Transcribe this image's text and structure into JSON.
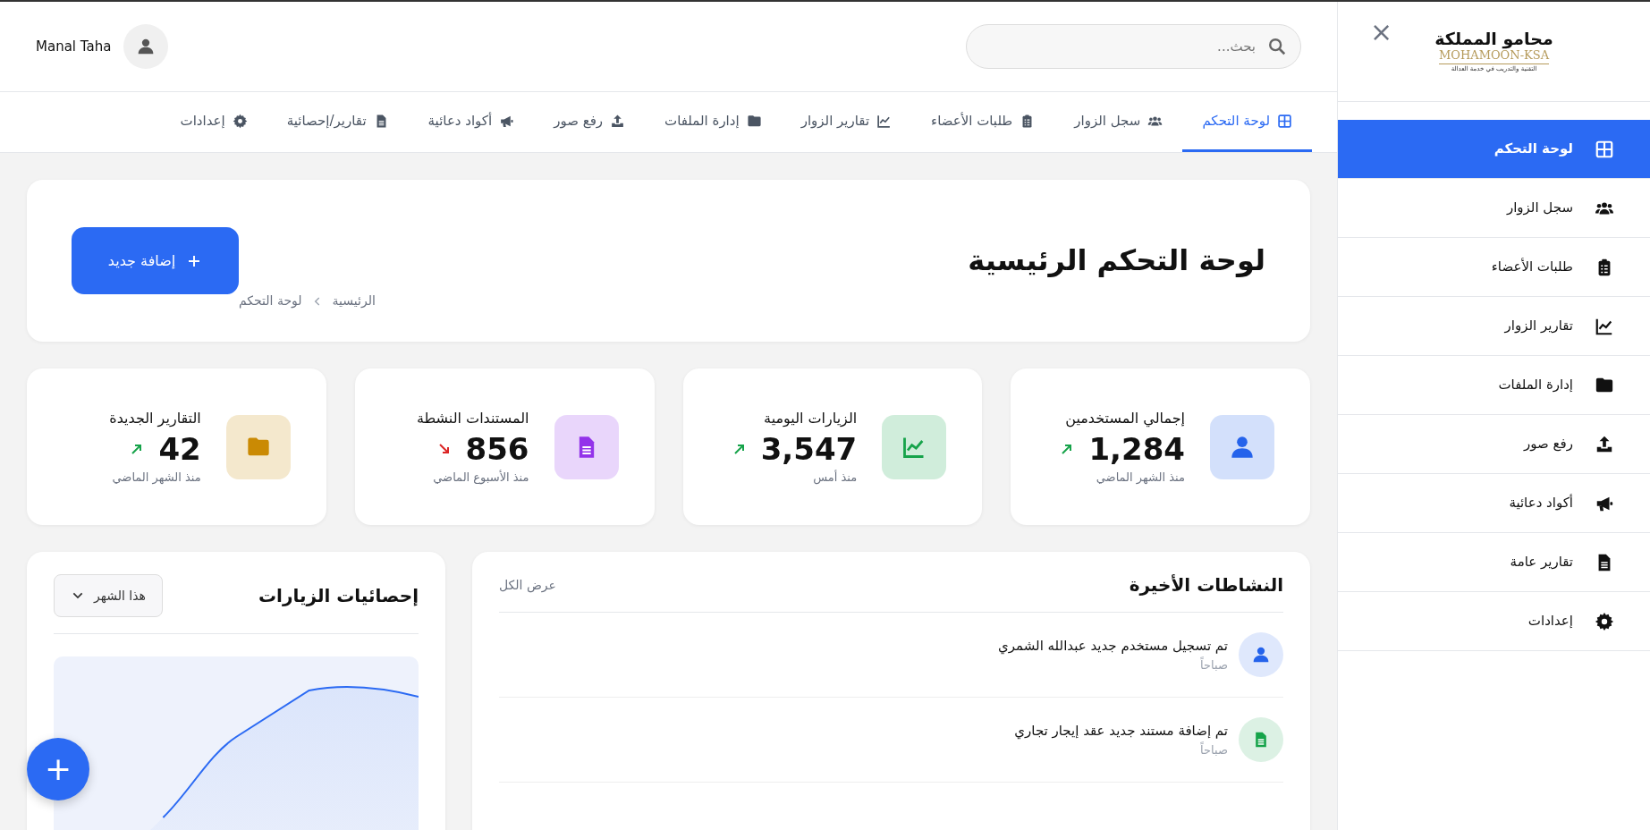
{
  "sidebar": {
    "logo": {
      "title": "محامو المملكة",
      "subtitle": "MOHAMOON-KSA",
      "tagline": "التقنية والتدريب في خدمة العدالة"
    },
    "close": "×",
    "items": [
      {
        "label": "لوحة التحكم",
        "selected": true
      },
      {
        "label": "سجل الزوار",
        "selected": false
      },
      {
        "label": "طلبات الأعضاء",
        "selected": false
      },
      {
        "label": "تقارير الزوار",
        "selected": false
      },
      {
        "label": "إدارة الملفات",
        "selected": false
      },
      {
        "label": "رفع صور",
        "selected": false
      },
      {
        "label": "أكواد دعائية",
        "selected": false
      },
      {
        "label": "تقارير عامة",
        "selected": false
      },
      {
        "label": "إعدادات",
        "selected": false
      }
    ]
  },
  "topbar": {
    "search": {
      "placeholder": "بحث..."
    },
    "user": {
      "name": "Manal Taha"
    }
  },
  "tabs": [
    {
      "label": "لوحة التحكم",
      "selected": true
    },
    {
      "label": "سجل الزوار",
      "selected": false
    },
    {
      "label": "طلبات الأعضاء",
      "selected": false
    },
    {
      "label": "تقارير الزوار",
      "selected": false
    },
    {
      "label": "إدارة الملفات",
      "selected": false
    },
    {
      "label": "رفع صور",
      "selected": false
    },
    {
      "label": "أكواد دعائية",
      "selected": false
    },
    {
      "label": "تقارير/إحصائية",
      "selected": false
    },
    {
      "label": "إعدادات",
      "selected": false
    }
  ],
  "header": {
    "title": "لوحة التحكم الرئيسية",
    "breadcrumb": [
      "الرئيسية",
      "لوحة التحكم"
    ],
    "button": "إضافة جديد"
  },
  "stats": [
    {
      "label": "إجمالي المستخدمين",
      "value": "1,284",
      "rising": true,
      "note": "منذ الشهر الماضي",
      "color": "#2563eb"
    },
    {
      "label": "الزيارات اليومية",
      "value": "3,547",
      "rising": true,
      "note": "منذ أمس",
      "color": "#16a34a"
    },
    {
      "label": "المستندات النشطة",
      "value": "856",
      "rising": false,
      "note": "منذ الأسبوع الماضي",
      "color": "#9333ea"
    },
    {
      "label": "التقارير الجديدة",
      "value": "42",
      "rising": true,
      "note": "منذ الشهر الماضي",
      "color": "#ca8a04"
    }
  ],
  "activities": {
    "title": "النشاطات الأخيرة",
    "view_all": "عرض الكل",
    "items": [
      {
        "text": "تم تسجيل مستخدم جديد عبدالله الشمري",
        "time": "صباحاً",
        "color": "#2563eb"
      },
      {
        "text": "تم إضافة مستند جديد عقد إيجار تجاري",
        "time": "صباحاً",
        "color": "#16a34a"
      }
    ]
  },
  "visits": {
    "title": "إحصائيات الزيارات",
    "period": "هذا الشهر"
  },
  "fab": "+"
}
